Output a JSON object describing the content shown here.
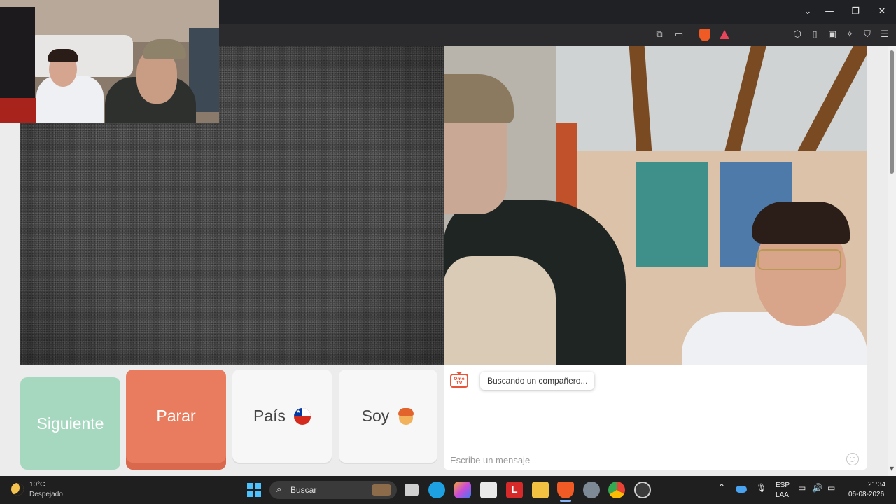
{
  "controls": {
    "next_label": "Siguiente",
    "stop_label": "Parar",
    "country_label": "País",
    "gender_label": "Soy"
  },
  "chat": {
    "logo_text": "Ome TV",
    "status_message": "Buscando un compañero...",
    "input_placeholder": "Escribe un mensaje"
  },
  "taskbar": {
    "weather_temp": "10°C",
    "weather_desc": "Despejado",
    "search_placeholder": "Buscar",
    "language": "ESP",
    "layout": "LAA",
    "time": "21:34",
    "date": "06-08-2026"
  },
  "colors": {
    "next_button": "#a6d8bf",
    "stop_button": "#e97c5f",
    "neutral_button": "#f7f7f7",
    "accent_logo": "#e8553b"
  },
  "icons": {
    "country_flag": "chile-flag-icon",
    "gender_avatar": "boy-emoji-icon"
  }
}
